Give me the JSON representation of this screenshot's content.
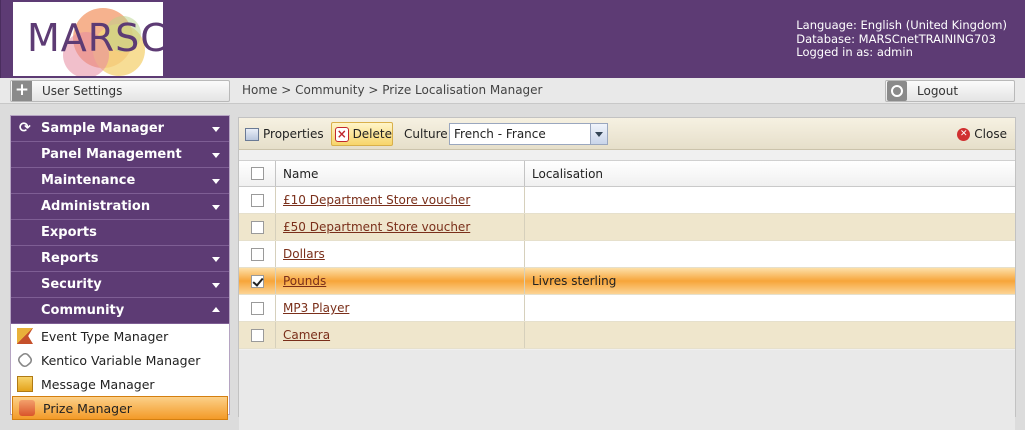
{
  "header": {
    "logo_text": "MARSC",
    "language": "Language: English (United Kingdom)",
    "database": "Database: MARSCnetTRAINING703",
    "logged_in": "Logged in as: admin"
  },
  "toprow": {
    "user_settings_label": "User Settings",
    "breadcrumb": "Home > Community > Prize Localisation Manager",
    "logout_label": "Logout"
  },
  "sidebar": {
    "items": [
      {
        "label": "Sample Manager",
        "state": "collapsed"
      },
      {
        "label": "Panel Management",
        "state": "collapsed"
      },
      {
        "label": "Maintenance",
        "state": "collapsed"
      },
      {
        "label": "Administration",
        "state": "collapsed"
      },
      {
        "label": "Exports",
        "state": "none"
      },
      {
        "label": "Reports",
        "state": "collapsed"
      },
      {
        "label": "Security",
        "state": "collapsed"
      },
      {
        "label": "Community",
        "state": "expanded"
      }
    ],
    "community_subitems": [
      {
        "label": "Event Type Manager",
        "icon": "flag-icon"
      },
      {
        "label": "Kentico Variable Manager",
        "icon": "link-icon"
      },
      {
        "label": "Message Manager",
        "icon": "message-icon"
      },
      {
        "label": "Prize Manager",
        "icon": "prize-icon",
        "active": true
      }
    ]
  },
  "toolbar": {
    "properties_label": "Properties",
    "delete_label": "Delete",
    "culture_label": "Culture",
    "culture_value": "French - France",
    "close_label": "Close"
  },
  "grid": {
    "columns": [
      "Name",
      "Localisation"
    ],
    "rows": [
      {
        "name": "£10 Department Store voucher",
        "localisation": "",
        "checked": false
      },
      {
        "name": "£50 Department Store voucher",
        "localisation": "",
        "checked": false
      },
      {
        "name": "Dollars",
        "localisation": "",
        "checked": false
      },
      {
        "name": "Pounds",
        "localisation": "Livres sterling",
        "checked": true
      },
      {
        "name": "MP3 Player",
        "localisation": "",
        "checked": false
      },
      {
        "name": "Camera",
        "localisation": "",
        "checked": false
      }
    ]
  }
}
